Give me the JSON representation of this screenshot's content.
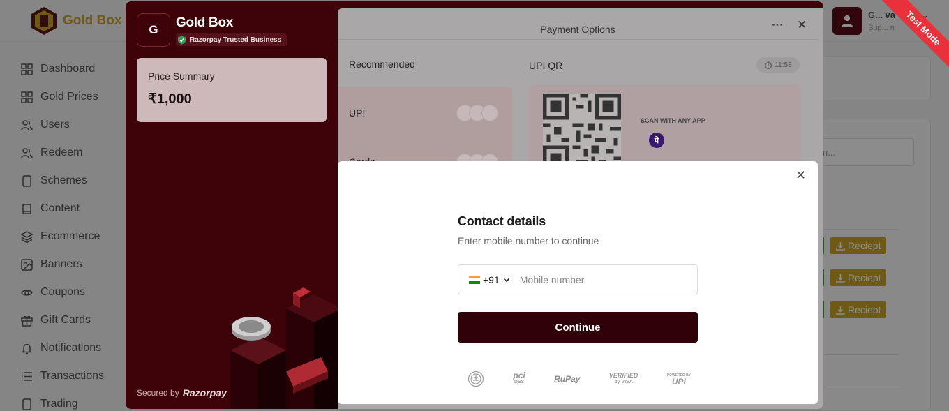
{
  "app": {
    "brand_name": "Gold Box",
    "user_name": "G... va",
    "user_role": "Sup... n"
  },
  "sidebar": {
    "items": [
      {
        "label": "Dashboard",
        "icon": "grid-icon"
      },
      {
        "label": "Gold Prices",
        "icon": "grid-icon"
      },
      {
        "label": "Users",
        "icon": "users-icon"
      },
      {
        "label": "Redeem",
        "icon": "users-icon"
      },
      {
        "label": "Schemes",
        "icon": "phone-icon"
      },
      {
        "label": "Content",
        "icon": "book-icon"
      },
      {
        "label": "Ecommerce",
        "icon": "layers-icon"
      },
      {
        "label": "Banners",
        "icon": "image-icon"
      },
      {
        "label": "Coupons",
        "icon": "eye-icon"
      },
      {
        "label": "Gift Cards",
        "icon": "gift-icon"
      },
      {
        "label": "Notifications",
        "icon": "bell-icon"
      },
      {
        "label": "Transactions",
        "icon": "list-icon"
      },
      {
        "label": "Trading",
        "icon": "phone-icon"
      }
    ]
  },
  "background": {
    "search_placeholder": "n...",
    "receipt_label": "Reciept"
  },
  "test_mode_label": "Test Mode",
  "checkout": {
    "merchant_initial": "G",
    "merchant_name": "Gold Box",
    "trusted_label": "Razorpay Trusted Business",
    "price_summary_label": "Price Summary",
    "price_amount": "₹1,000",
    "secured_by": "Secured by",
    "razorpay_brand": "Razorpay",
    "payment_options_title": "Payment Options",
    "recommended_label": "Recommended",
    "upi_qr_label": "UPI QR",
    "timer": "11:53",
    "upi_label": "UPI",
    "cards_label": "Cards",
    "scan_label": "SCAN WITH ANY APP",
    "phonepe_glyph": "पे"
  },
  "contact_modal": {
    "title": "Contact details",
    "subtitle": "Enter mobile number to continue",
    "country_code": "+91",
    "mobile_placeholder": "Mobile number",
    "mobile_value": "",
    "continue_label": "Continue",
    "badges": {
      "pci": "pci",
      "pci_sub": "DSS",
      "rupay": "RuPay",
      "verified": "VERIFIED",
      "by_visa": "by VISA",
      "powered_by": "POWERED BY",
      "upi": "UPI"
    }
  },
  "colors": {
    "checkout_bg": "#3d0309",
    "primary_button": "#2e0208",
    "gold": "#c9a227",
    "test_mode": "#e8313a"
  }
}
